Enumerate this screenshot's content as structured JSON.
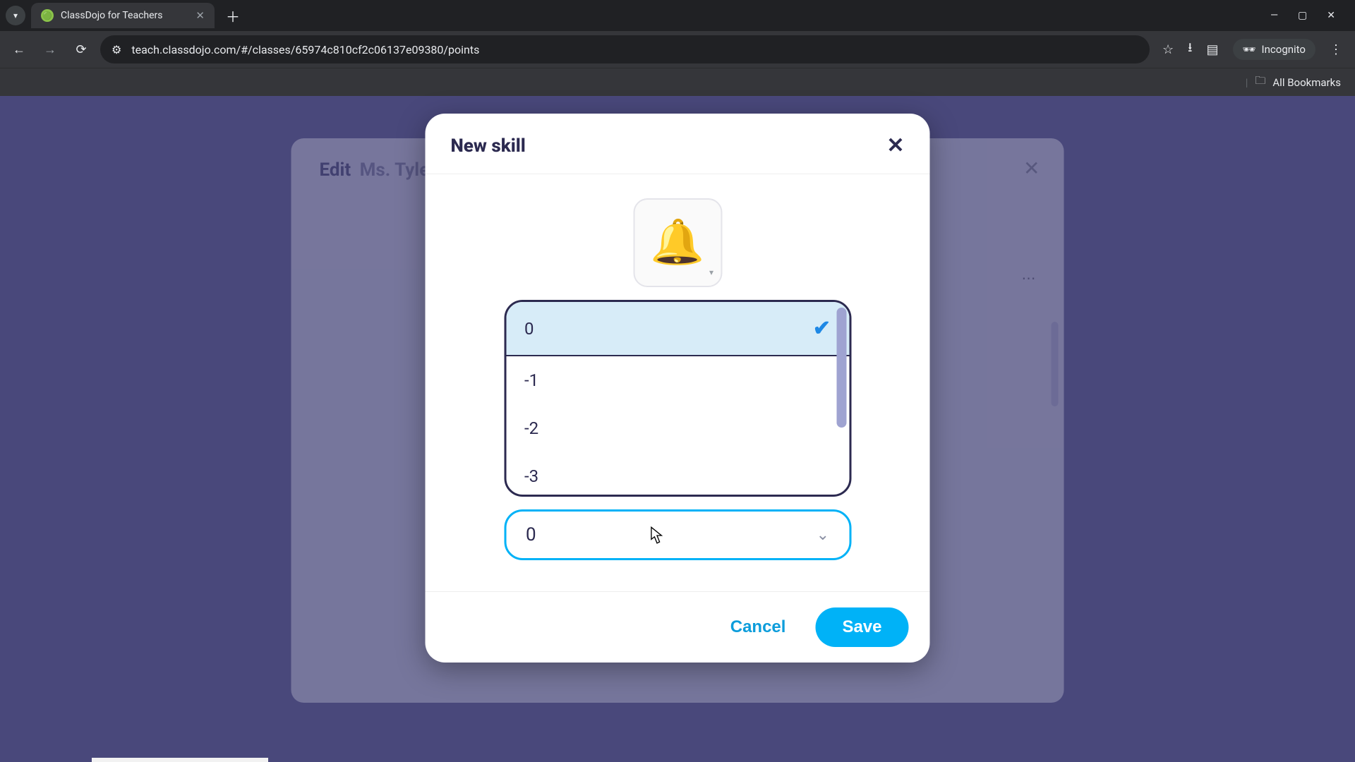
{
  "browser": {
    "tab_title": "ClassDojo for Teachers",
    "url": "teach.classdojo.com/#/classes/65974c810cf2c06137e09380/points",
    "incognito_label": "Incognito",
    "all_bookmarks": "All Bookmarks"
  },
  "background_modal": {
    "title_prefix": "Edit",
    "title_rest": "Ms. Tyler's"
  },
  "modal": {
    "title": "New skill",
    "icon_name": "bell-icon",
    "dropdown": {
      "selected_value": "0",
      "visible_options": [
        "0",
        "-1",
        "-2",
        "-3"
      ]
    },
    "points_select_value": "0",
    "cancel_label": "Cancel",
    "save_label": "Save"
  }
}
